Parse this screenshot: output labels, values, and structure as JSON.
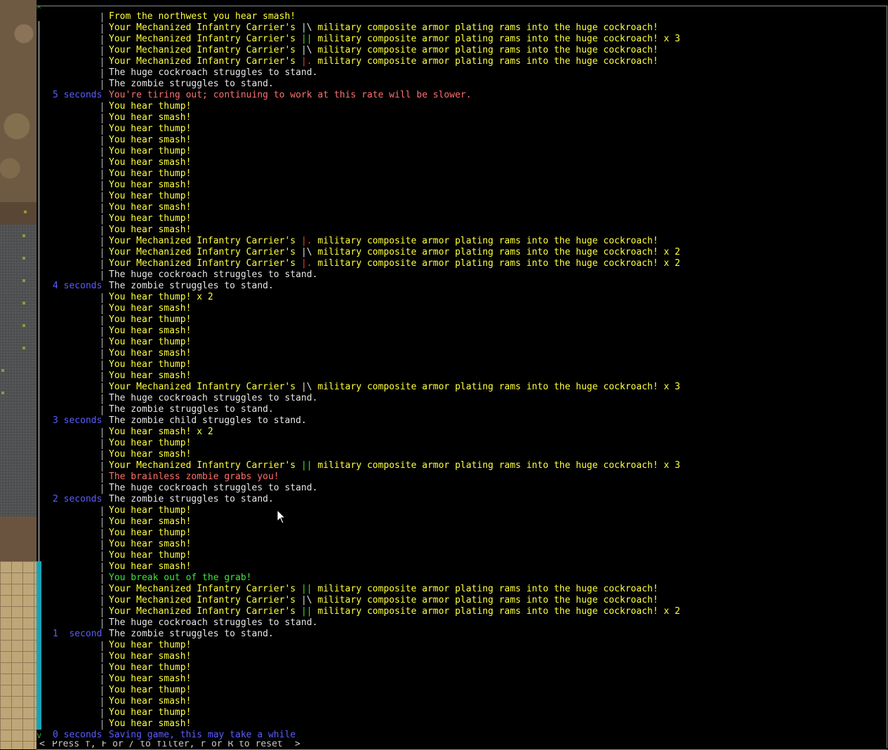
{
  "scroll_up_icon": "^",
  "scroll_down_icon": "v",
  "footer": {
    "left_arrow": "<",
    "hint": "Press f, F or / to filter, r or R to reset",
    "right_arrow": ">"
  },
  "colors": {
    "time": "#5c5cff",
    "yellow": "#ffff3c",
    "white": "#e6e6e6",
    "pink": "#ff7070",
    "green": "#3ce63c",
    "scrollbar": "#19a3b8"
  },
  "log": [
    {
      "time": "",
      "text": "From the northwest you hear smash!",
      "color": "yellow"
    },
    {
      "time": "",
      "color": "yellow",
      "pre": "Your Mechanized Infantry Carrier's ",
      "sym": "|\\",
      "sym_color": "white",
      "post": " military composite armor plating rams into the huge cockroach!"
    },
    {
      "time": "",
      "color": "yellow",
      "pre": "Your Mechanized Infantry Carrier's ",
      "sym": "||",
      "sym_color": "green",
      "post": " military composite armor plating rams into the huge cockroach! x 3"
    },
    {
      "time": "",
      "color": "yellow",
      "pre": "Your Mechanized Infantry Carrier's ",
      "sym": "|\\",
      "sym_color": "white",
      "post": " military composite armor plating rams into the huge cockroach!"
    },
    {
      "time": "",
      "color": "yellow",
      "pre": "Your Mechanized Infantry Carrier's ",
      "sym": "|.",
      "sym_color": "red",
      "post": " military composite armor plating rams into the huge cockroach!"
    },
    {
      "time": "",
      "text": "The huge cockroach struggles to stand.",
      "color": "white"
    },
    {
      "time": "",
      "text": "The zombie struggles to stand.",
      "color": "white"
    },
    {
      "time": "5 seconds",
      "text": "You're tiring out; continuing to work at this rate will be slower.",
      "color": "pink"
    },
    {
      "time": "",
      "text": "You hear thump!",
      "color": "yellow"
    },
    {
      "time": "",
      "text": "You hear smash!",
      "color": "yellow"
    },
    {
      "time": "",
      "text": "You hear thump!",
      "color": "yellow"
    },
    {
      "time": "",
      "text": "You hear smash!",
      "color": "yellow"
    },
    {
      "time": "",
      "text": "You hear thump!",
      "color": "yellow"
    },
    {
      "time": "",
      "text": "You hear smash!",
      "color": "yellow"
    },
    {
      "time": "",
      "text": "You hear thump!",
      "color": "yellow"
    },
    {
      "time": "",
      "text": "You hear smash!",
      "color": "yellow"
    },
    {
      "time": "",
      "text": "You hear thump!",
      "color": "yellow"
    },
    {
      "time": "",
      "text": "You hear smash!",
      "color": "yellow"
    },
    {
      "time": "",
      "text": "You hear thump!",
      "color": "yellow"
    },
    {
      "time": "",
      "text": "You hear smash!",
      "color": "yellow"
    },
    {
      "time": "",
      "color": "yellow",
      "pre": "Your Mechanized Infantry Carrier's ",
      "sym": "|.",
      "sym_color": "red",
      "post": " military composite armor plating rams into the huge cockroach!"
    },
    {
      "time": "",
      "color": "yellow",
      "pre": "Your Mechanized Infantry Carrier's ",
      "sym": "|\\",
      "sym_color": "white",
      "post": " military composite armor plating rams into the huge cockroach! x 2"
    },
    {
      "time": "",
      "color": "yellow",
      "pre": "Your Mechanized Infantry Carrier's ",
      "sym": "|.",
      "sym_color": "red",
      "post": " military composite armor plating rams into the huge cockroach! x 2"
    },
    {
      "time": "",
      "text": "The huge cockroach struggles to stand.",
      "color": "white"
    },
    {
      "time": "4 seconds",
      "text": "The zombie struggles to stand.",
      "color": "white"
    },
    {
      "time": "",
      "text": "You hear thump! x 2",
      "color": "yellow"
    },
    {
      "time": "",
      "text": "You hear smash!",
      "color": "yellow"
    },
    {
      "time": "",
      "text": "You hear thump!",
      "color": "yellow"
    },
    {
      "time": "",
      "text": "You hear smash!",
      "color": "yellow"
    },
    {
      "time": "",
      "text": "You hear thump!",
      "color": "yellow"
    },
    {
      "time": "",
      "text": "You hear smash!",
      "color": "yellow"
    },
    {
      "time": "",
      "text": "You hear thump!",
      "color": "yellow"
    },
    {
      "time": "",
      "text": "You hear smash!",
      "color": "yellow"
    },
    {
      "time": "",
      "color": "yellow",
      "pre": "Your Mechanized Infantry Carrier's ",
      "sym": "|\\",
      "sym_color": "white",
      "post": " military composite armor plating rams into the huge cockroach! x 3"
    },
    {
      "time": "",
      "text": "The huge cockroach struggles to stand.",
      "color": "white"
    },
    {
      "time": "",
      "text": "The zombie struggles to stand.",
      "color": "white"
    },
    {
      "time": "3 seconds",
      "text": "The zombie child struggles to stand.",
      "color": "white"
    },
    {
      "time": "",
      "text": "You hear smash! x 2",
      "color": "yellow"
    },
    {
      "time": "",
      "text": "You hear thump!",
      "color": "yellow"
    },
    {
      "time": "",
      "text": "You hear smash!",
      "color": "yellow"
    },
    {
      "time": "",
      "color": "yellow",
      "pre": "Your Mechanized Infantry Carrier's ",
      "sym": "||",
      "sym_color": "green",
      "post": " military composite armor plating rams into the huge cockroach! x 3"
    },
    {
      "time": "",
      "text": "The brainless zombie grabs you!",
      "color": "pink"
    },
    {
      "time": "",
      "text": "The huge cockroach struggles to stand.",
      "color": "white"
    },
    {
      "time": "2 seconds",
      "text": "The zombie struggles to stand.",
      "color": "white"
    },
    {
      "time": "",
      "text": "You hear thump!",
      "color": "yellow"
    },
    {
      "time": "",
      "text": "You hear smash!",
      "color": "yellow"
    },
    {
      "time": "",
      "text": "You hear thump!",
      "color": "yellow"
    },
    {
      "time": "",
      "text": "You hear smash!",
      "color": "yellow"
    },
    {
      "time": "",
      "text": "You hear thump!",
      "color": "yellow"
    },
    {
      "time": "",
      "text": "You hear smash!",
      "color": "yellow"
    },
    {
      "time": "",
      "text": "You break out of the grab!",
      "color": "green"
    },
    {
      "time": "",
      "color": "yellow",
      "pre": "Your Mechanized Infantry Carrier's ",
      "sym": "||",
      "sym_color": "green",
      "post": " military composite armor plating rams into the huge cockroach!"
    },
    {
      "time": "",
      "color": "yellow",
      "pre": "Your Mechanized Infantry Carrier's ",
      "sym": "|\\",
      "sym_color": "white",
      "post": " military composite armor plating rams into the huge cockroach!"
    },
    {
      "time": "",
      "color": "yellow",
      "pre": "Your Mechanized Infantry Carrier's ",
      "sym": "||",
      "sym_color": "green",
      "post": " military composite armor plating rams into the huge cockroach! x 2"
    },
    {
      "time": "",
      "text": "The huge cockroach struggles to stand.",
      "color": "white"
    },
    {
      "time": "1  second",
      "text": "The zombie struggles to stand.",
      "color": "white"
    },
    {
      "time": "",
      "text": "You hear thump!",
      "color": "yellow"
    },
    {
      "time": "",
      "text": "You hear smash!",
      "color": "yellow"
    },
    {
      "time": "",
      "text": "You hear thump!",
      "color": "yellow"
    },
    {
      "time": "",
      "text": "You hear smash!",
      "color": "yellow"
    },
    {
      "time": "",
      "text": "You hear thump!",
      "color": "yellow"
    },
    {
      "time": "",
      "text": "You hear smash!",
      "color": "yellow"
    },
    {
      "time": "",
      "text": "You hear thump!",
      "color": "yellow"
    },
    {
      "time": "",
      "text": "You hear smash!",
      "color": "yellow"
    },
    {
      "time": "0 seconds",
      "text": "Saving game, this may take a while",
      "color": "blue"
    }
  ]
}
